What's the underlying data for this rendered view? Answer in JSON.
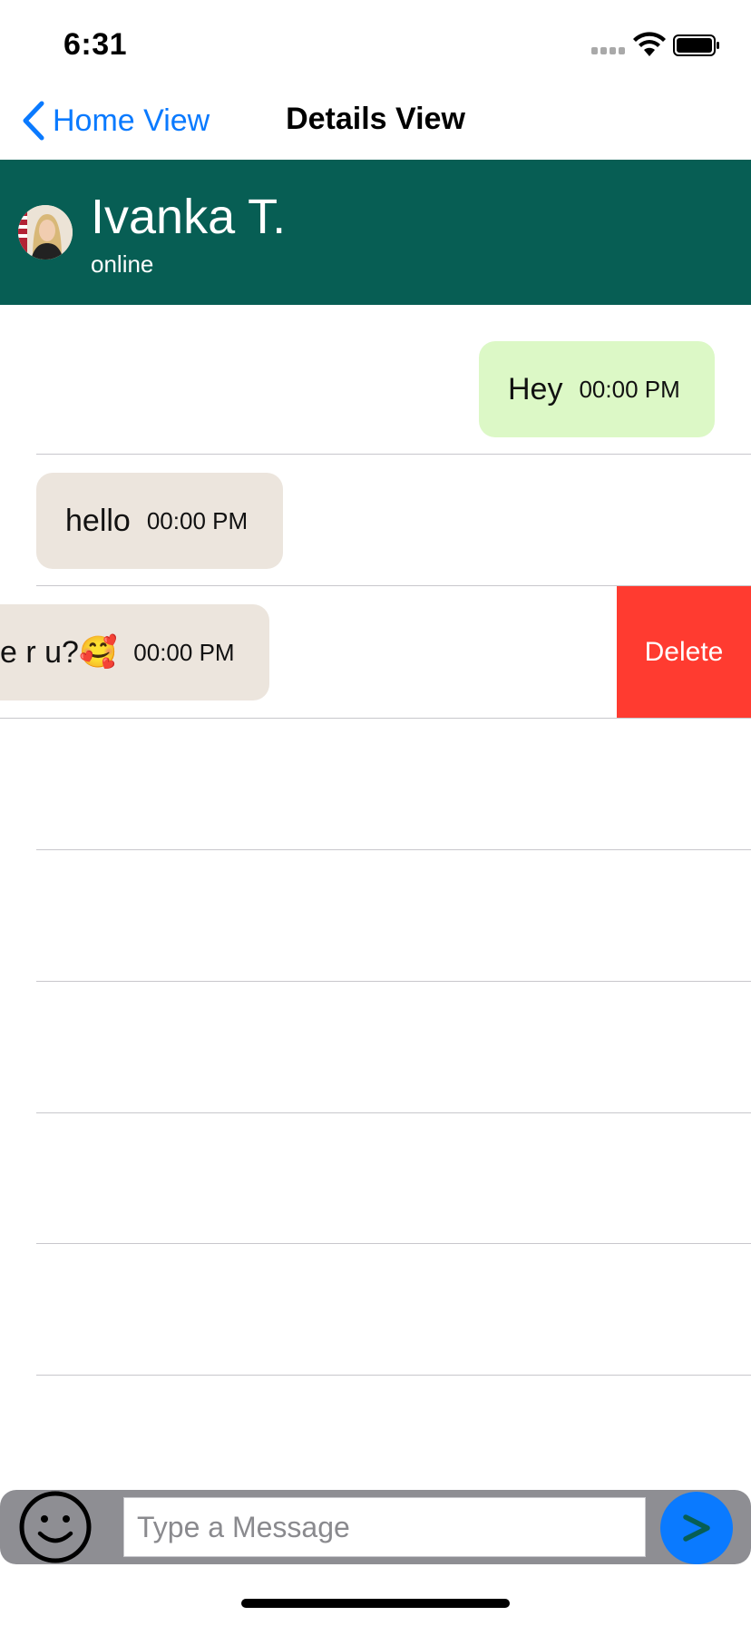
{
  "status_bar": {
    "time": "6:31"
  },
  "nav": {
    "back_label": "Home View",
    "title": "Details View"
  },
  "contact": {
    "name": "Ivanka T.",
    "status": "online"
  },
  "messages": [
    {
      "text": "Hey",
      "time": "00:00 PM",
      "direction": "outgoing"
    },
    {
      "text": "hello",
      "time": "00:00 PM",
      "direction": "incoming"
    },
    {
      "text": "e r u?🥰",
      "time": "00:00 PM",
      "direction": "incoming",
      "swiped": true
    }
  ],
  "row_action": {
    "delete_label": "Delete"
  },
  "composer": {
    "placeholder": "Type a Message",
    "value": ""
  },
  "colors": {
    "header": "#075e54",
    "outgoing_bubble": "#dcf8c6",
    "incoming_bubble": "#ece5dd",
    "delete": "#ff3b30",
    "link": "#0a7aff",
    "send_button": "#0a7aff",
    "send_icon": "#075e54"
  }
}
